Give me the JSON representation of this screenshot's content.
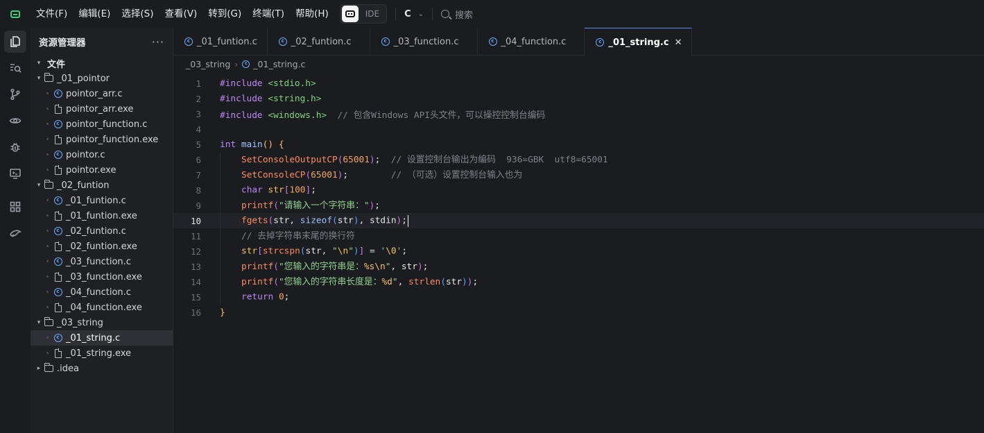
{
  "titlebar": {
    "menus": [
      "文件(F)",
      "编辑(E)",
      "选择(S)",
      "查看(V)",
      "转到(G)",
      "终端(T)",
      "帮助(H)"
    ],
    "ide_label": "IDE",
    "language": "C",
    "search_label": "搜索"
  },
  "activity_bar": {
    "items": [
      "explorer-icon",
      "search-code-icon",
      "source-control-icon",
      "preview-icon",
      "debug-icon",
      "remote-icon",
      "extensions-icon",
      "ai-assistant-icon"
    ]
  },
  "sidebar": {
    "title": "资源管理器",
    "more": "···",
    "root": "文件",
    "folders": {
      "pointor": "_01_pointor",
      "funtion": "_02_funtion",
      "string": "_03_string",
      "idea": ".idea"
    },
    "files": {
      "pointor_arr_c": "pointor_arr.c",
      "pointor_arr_exe": "pointor_arr.exe",
      "pointor_function_c": "pointor_function.c",
      "pointor_function_exe": "pointor_function.exe",
      "pointor_c": "pointor.c",
      "pointor_exe": "pointor.exe",
      "f01_c": "_01_funtion.c",
      "f01_exe": "_01_funtion.exe",
      "f02_c": "_02_funtion.c",
      "f02_exe": "_02_funtion.exe",
      "f03_c": "_03_function.c",
      "f03_exe": "_03_function.exe",
      "f04_c": "_04_function.c",
      "f04_exe": "_04_function.exe",
      "s01_c": "_01_string.c",
      "s01_exe": "_01_string.exe"
    }
  },
  "tabs": [
    "_01_funtion.c",
    "_02_funtion.c",
    "_03_function.c",
    "_04_function.c",
    "_01_string.c"
  ],
  "active_tab_close": "✕",
  "breadcrumb": {
    "folder": "_03_string",
    "file": "_01_string.c"
  },
  "editor": {
    "current_line": 10,
    "line_numbers": [
      "1",
      "2",
      "3",
      "4",
      "5",
      "6",
      "7",
      "8",
      "9",
      "10",
      "11",
      "12",
      "13",
      "14",
      "15",
      "16"
    ],
    "t": {
      "include": "#include",
      "stdio": "<stdio.h>",
      "string": "<string.h>",
      "windows": "<windows.h>",
      "c3": "// 包含Windows API头文件，可以操控控制台编码",
      "int": "int",
      "main": "main",
      "paren_open": "(",
      "paren_close": ")",
      "brace_open": "{",
      "brace_close": "}",
      "setout": "SetConsoleOutputCP",
      "n65001": "65001",
      "semi": ";",
      "c6": "// 设置控制台输出为编码  936=GBK  utf8=65001",
      "setcp": "SetConsoleCP",
      "c7": "// （可选）设置控制台输入也为",
      "char": "char",
      "str": "str",
      "bracket_open": "[",
      "bracket_close": "]",
      "n100": "100",
      "printf": "printf",
      "s9": "\"请输入一个字符串：\"",
      "fgets": "fgets",
      "comma": ", ",
      "sizeof": "sizeof",
      "stdin": "stdin",
      "c11": "// 去掉字符串末尾的换行符",
      "strcspn": "strcspn",
      "q": "\"",
      "esc_n": "\\n",
      "eq": " = ",
      "zero_char_q": "'",
      "esc_0": "\\0",
      "s13": "\"您输入的字符串是：",
      "fmt_s": "%s",
      "s14": "\"您输入的字符串长度是：",
      "fmt_d": "%d",
      "strlen": "strlen",
      "return": "return",
      "n0": "0"
    }
  }
}
